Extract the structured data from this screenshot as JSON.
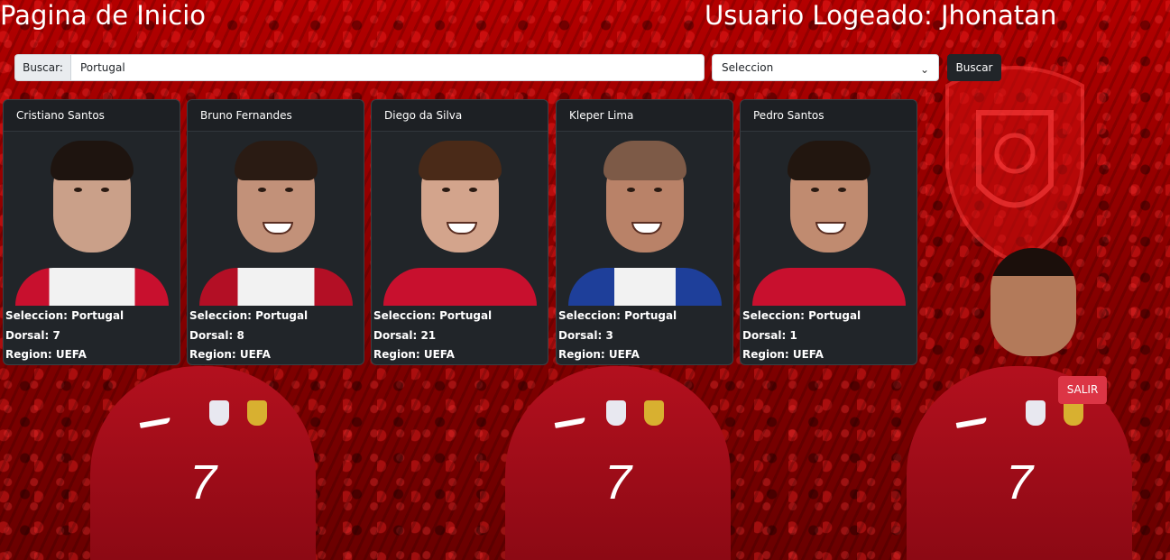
{
  "header": {
    "title": "Pagina de Inicio",
    "user": "Usuario Logeado: Jhonatan"
  },
  "search": {
    "label": "Buscar:",
    "value": "Portugal",
    "select_value": "Seleccion",
    "button": "Buscar"
  },
  "players": [
    {
      "name": "Cristiano Santos",
      "seleccion": "Seleccion: Portugal",
      "dorsal": "Dorsal: 7",
      "region": "Region: UEFA"
    },
    {
      "name": "Bruno Fernandes",
      "seleccion": "Seleccion: Portugal",
      "dorsal": "Dorsal: 8",
      "region": "Region: UEFA"
    },
    {
      "name": "Diego da Silva",
      "seleccion": "Seleccion: Portugal",
      "dorsal": "Dorsal: 21",
      "region": "Region: UEFA"
    },
    {
      "name": "Kleper Lima",
      "seleccion": "Seleccion: Portugal",
      "dorsal": "Dorsal: 3",
      "region": "Region: UEFA"
    },
    {
      "name": "Pedro Santos",
      "seleccion": "Seleccion: Portugal",
      "dorsal": "Dorsal: 1",
      "region": "Region: UEFA"
    }
  ],
  "logout": "SALIR",
  "background_jersey_number": "7",
  "colors": {
    "card_bg": "#212529",
    "danger": "#dc3545",
    "dark_button": "#212529",
    "background": "#9b0000"
  }
}
